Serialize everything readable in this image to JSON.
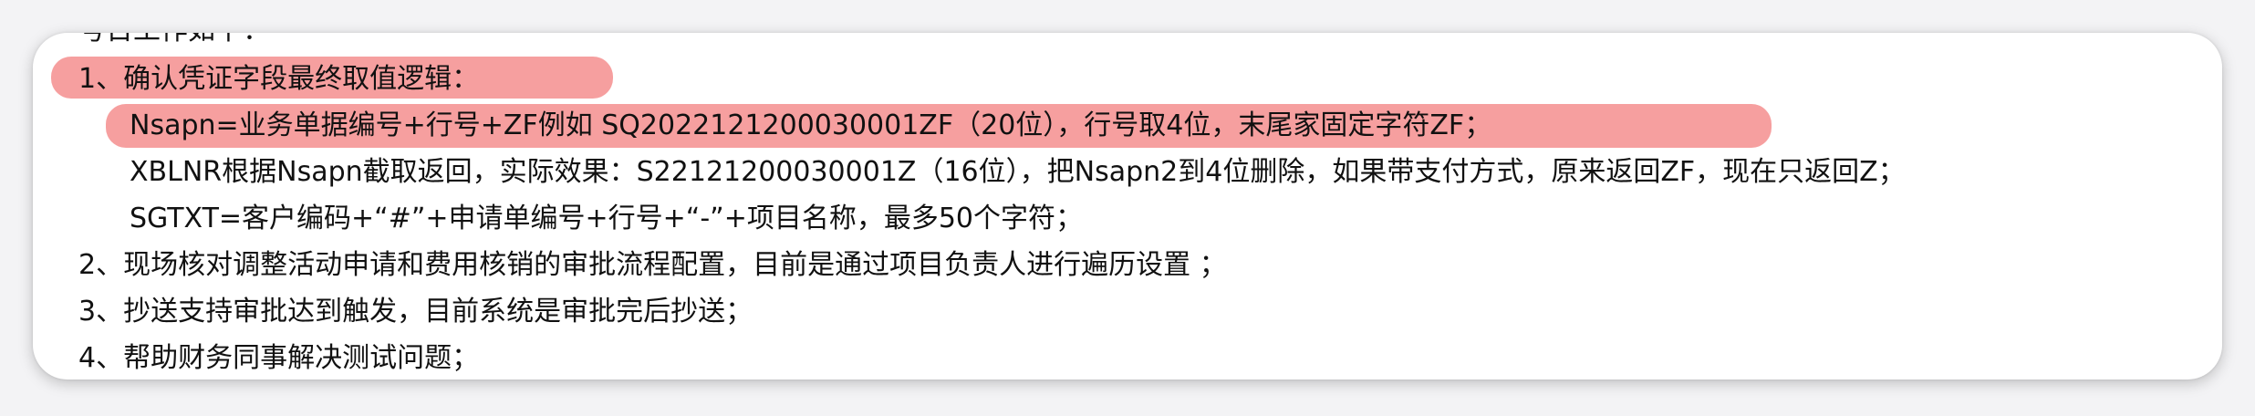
{
  "document": {
    "partial_top": "号日工作如下：",
    "items": [
      "1、确认凭证字段最终取值逻辑：",
      "Nsapn=业务单据编号+行号+ZF例如 SQ2022121200030001ZF（20位），行号取4位，末尾家固定字符ZF；",
      "XBLNR根据Nsapn截取返回，实际效果：S22121200030001Z（16位），把Nsapn2到4位删除，如果带支付方式，原来返回ZF，现在只返回Z；",
      "SGTXT=客户编码+“#”+申请单编号+行号+“-”+项目名称，最多50个字符；",
      "2、现场核对调整活动申请和费用核销的审批流程配置，目前是通过项目负责人进行遍历设置 ；",
      "3、抄送支持审批达到触发，目前系统是审批完后抄送；",
      "4、帮助财务同事解决测试问题；"
    ]
  },
  "colors": {
    "highlight": "#f48e8e",
    "text": "#111111",
    "card": "#ffffff"
  }
}
